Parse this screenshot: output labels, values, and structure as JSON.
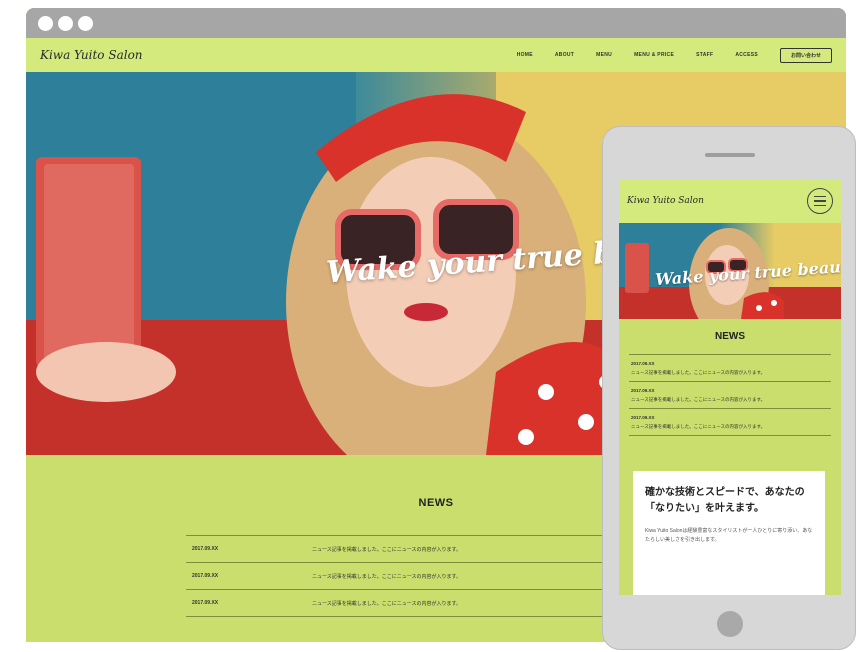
{
  "desktop": {
    "site": {
      "logo": "Kiwa Yuito Salon",
      "nav": [
        "HOME",
        "ABOUT",
        "MENU",
        "MENU & PRICE",
        "STAFF",
        "ACCESS"
      ],
      "nav_button": "お問い合わせ"
    },
    "hero": {
      "tagline": "Wake your true beauty."
    },
    "news": {
      "title": "NEWS",
      "items": [
        {
          "date": "2017.09.XX",
          "text": "ニュース記事を掲載しました。ここにニュースの内容が入ります。"
        },
        {
          "date": "2017.09.XX",
          "text": "ニュース記事を掲載しました。ここにニュースの内容が入ります。"
        },
        {
          "date": "2017.09.XX",
          "text": "ニュース記事を掲載しました。ここにニュースの内容が入ります。"
        }
      ]
    }
  },
  "mobile": {
    "logo": "Kiwa Yuito Salon",
    "tagline": "Wake your true beauty.",
    "news_title": "NEWS",
    "news_items": [
      {
        "date": "2017.09.XX",
        "text": "ニュース記事を掲載しました。ここにニュースの内容が入ります。"
      },
      {
        "date": "2017.09.XX",
        "text": "ニュース記事を掲載しました。ここにニュースの内容が入ります。"
      },
      {
        "date": "2017.09.XX",
        "text": "ニュース記事を掲載しました。ここにニュースの内容が入ります。"
      }
    ],
    "card": {
      "heading": "確かな技術とスピードで、あなたの「なりたい」を叶えます。",
      "body": "Kiwa Yuito Salonは経験豊富なスタイリストが一人ひとりに寄り添い、あなたらしい美しさを引き出します。"
    }
  },
  "colors": {
    "lime": "#c9de6c",
    "teal": "#2d7f9a",
    "red": "#c4312a",
    "yellow": "#e7cb64"
  }
}
